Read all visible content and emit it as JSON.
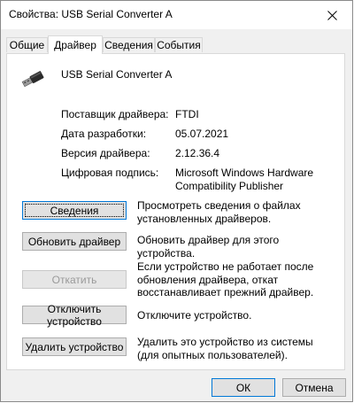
{
  "window": {
    "title": "Свойства: USB Serial Converter A"
  },
  "tabs": [
    {
      "label": "Общие"
    },
    {
      "label": "Драйвер",
      "active": true
    },
    {
      "label": "Сведения"
    },
    {
      "label": "События"
    }
  ],
  "device": {
    "name": "USB Serial Converter A",
    "icon": "usb-connector-icon"
  },
  "driver_info": [
    {
      "label": "Поставщик драйвера:",
      "value": "FTDI"
    },
    {
      "label": "Дата разработки:",
      "value": "05.07.2021"
    },
    {
      "label": "Версия драйвера:",
      "value": "2.12.36.4"
    },
    {
      "label": "Цифровая подпись:",
      "value": "Microsoft Windows Hardware Compatibility Publisher"
    }
  ],
  "actions": [
    {
      "button": "Сведения",
      "description": "Просмотреть сведения о файлах установленных драйверов."
    },
    {
      "button": "Обновить драйвер",
      "description": "Обновить драйвер для этого устройства."
    },
    {
      "button": "Откатить",
      "description": "Если устройство не работает после обновления драйвера, откат восстанавливает прежний драйвер.",
      "disabled": true
    },
    {
      "button": "Отключить устройство",
      "description": "Отключите устройство."
    },
    {
      "button": "Удалить устройство",
      "description": "Удалить это устройство из системы (для опытных пользователей)."
    }
  ],
  "footer": {
    "ok_label": "ОК",
    "cancel_label": "Отмена"
  },
  "colors": {
    "accent": "#0078d7",
    "window_bg": "#f0f0f0",
    "button_bg": "#e1e1e1"
  }
}
